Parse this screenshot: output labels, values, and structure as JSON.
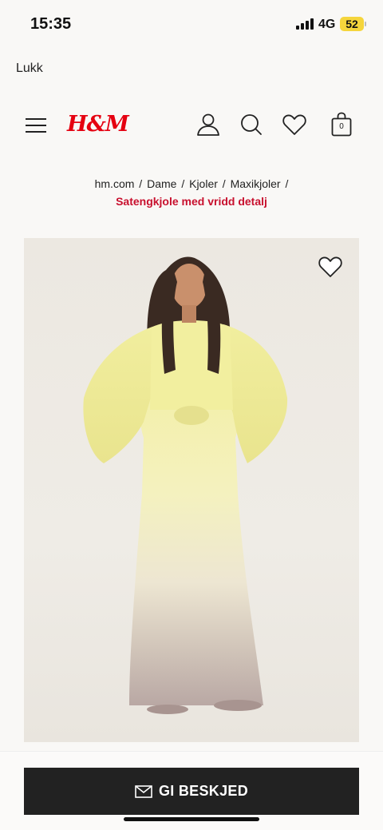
{
  "status_bar": {
    "time": "15:35",
    "network": "4G",
    "battery": "52"
  },
  "close_label": "Lukk",
  "header": {
    "logo": "H&M",
    "bag_count": "0",
    "icons": [
      "menu-icon",
      "account-icon",
      "search-icon",
      "heart-icon",
      "shopping-bag-icon"
    ]
  },
  "breadcrumb": {
    "items": [
      "hm.com",
      "Dame",
      "Kjoler",
      "Maxikjoler"
    ],
    "separator": "/",
    "current": "Satengkjole med vridd detalj"
  },
  "product": {
    "image_icon": "heart-icon"
  },
  "notify_button": {
    "label": "GI BESKJED",
    "icon": "mail-icon"
  },
  "colors": {
    "brand_red": "#e50010",
    "breadcrumb_current": "#c8102e",
    "button_bg": "#222222"
  }
}
